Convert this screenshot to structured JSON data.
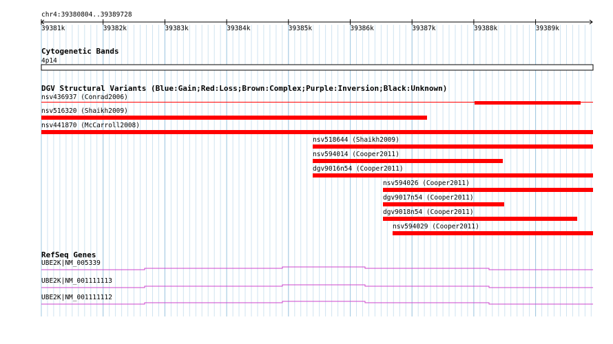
{
  "ruler": {
    "range_label": "chr4:39380804..39389728",
    "ticks": [
      "39381k",
      "39382k",
      "39383k",
      "39384k",
      "39385k",
      "39386k",
      "39387k",
      "39388k",
      "39389k"
    ]
  },
  "cytoband": {
    "title": "Cytogenetic Bands",
    "band": "4p14"
  },
  "dgv": {
    "title": "DGV Structural Variants (Blue:Gain;Red:Loss;Brown:Complex;Purple:Inversion;Black:Unknown)",
    "loss_color": "#ff0000",
    "variants": [
      {
        "label": "nsv436937 (Conrad2006)"
      },
      {
        "label": "nsv516320 (Shaikh2009)"
      },
      {
        "label": "nsv441870 (McCarroll2008)"
      },
      {
        "label": "nsv518644 (Shaikh2009)"
      },
      {
        "label": "nsv594014 (Cooper2011)"
      },
      {
        "label": "dgv9016n54 (Cooper2011)"
      },
      {
        "label": "nsv594026 (Cooper2011)"
      },
      {
        "label": "dgv9017n54 (Cooper2011)"
      },
      {
        "label": "dgv9018n54 (Cooper2011)"
      },
      {
        "label": "nsv594029 (Cooper2011)"
      }
    ]
  },
  "refseq": {
    "title": "RefSeq Genes",
    "gene_color": "#cc44cc",
    "genes": [
      {
        "label": "UBE2K|NM_005339"
      },
      {
        "label": "UBE2K|NM_001111113"
      },
      {
        "label": "UBE2K|NM_001111112"
      }
    ]
  },
  "colors": {
    "grid_major": "#9fc7e0",
    "grid_minor": "#cfe3f0"
  }
}
